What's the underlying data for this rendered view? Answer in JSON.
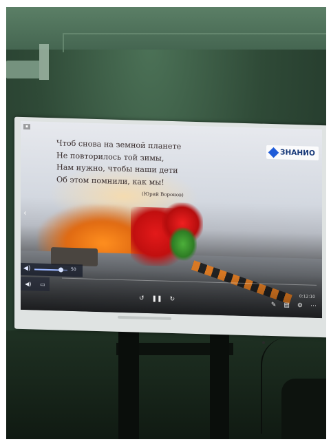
{
  "poem": {
    "lines": [
      "Чтоб снова на земной планете",
      "Не повторилось той зимы,",
      "Нам нужно, чтобы наши дети",
      "Об этом помнили, как мы!"
    ],
    "author": "(Юрий Воронов)"
  },
  "logo": {
    "text": "ЗНАНИО"
  },
  "player": {
    "volume_value": "50",
    "volume_level": 0.8,
    "time": "0:12:10",
    "icons": {
      "volume": "speaker-icon",
      "left_tools": [
        "speaker-icon",
        "caption-icon"
      ],
      "play_controls": [
        "rewind-icon",
        "pause-icon",
        "forward-icon"
      ],
      "right_controls": [
        "pen-icon",
        "subtitles-icon",
        "settings-icon",
        "more-icon"
      ],
      "nav_left": "chevron-left-icon"
    }
  }
}
